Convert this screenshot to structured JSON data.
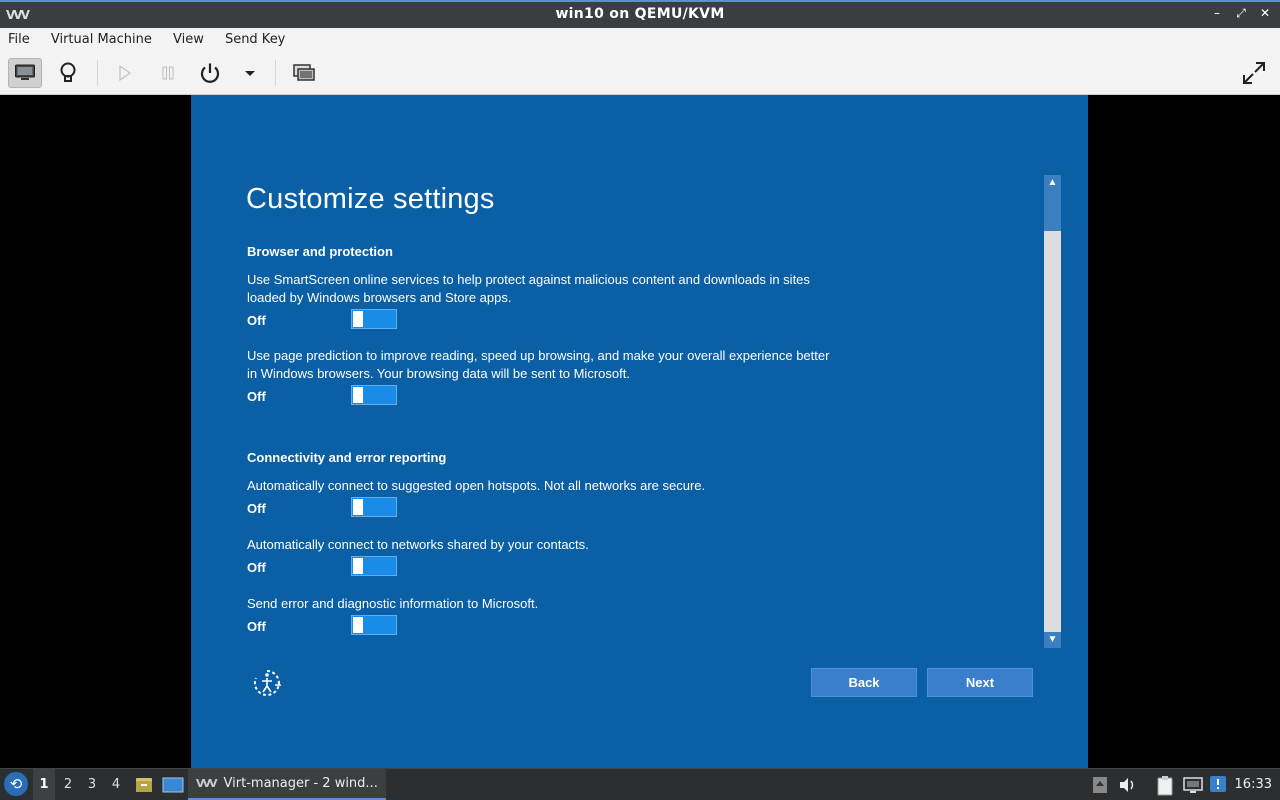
{
  "window": {
    "title": "win10 on QEMU/KVM",
    "app_icon_glyph": "VVV",
    "controls": {
      "minimize": "–",
      "maximize": "⤢",
      "close": "✕"
    }
  },
  "menubar": {
    "items": [
      "File",
      "Virtual Machine",
      "View",
      "Send Key"
    ]
  },
  "toolbar": {
    "icons": [
      "console-monitor-icon",
      "details-lightbulb-icon",
      "run-play-icon",
      "pause-icon",
      "power-icon",
      "power-menu-dropdown-icon",
      "snapshots-icon",
      "fullscreen-icon"
    ]
  },
  "oobe": {
    "heading": "Customize settings",
    "sections": [
      {
        "title": "Browser and protection",
        "settings": [
          {
            "text": "Use SmartScreen online services to help protect against malicious content and downloads in sites loaded by Windows browsers and Store apps.",
            "state": "Off"
          },
          {
            "text": "Use page prediction to improve reading, speed up browsing, and make your overall experience better in Windows browsers. Your browsing data will be sent to Microsoft.",
            "state": "Off"
          }
        ]
      },
      {
        "title": "Connectivity and error reporting",
        "settings": [
          {
            "text": "Automatically connect to suggested open hotspots. Not all networks are secure.",
            "state": "Off"
          },
          {
            "text": "Automatically connect to networks shared by your contacts.",
            "state": "Off"
          },
          {
            "text": "Send error and diagnostic information to Microsoft.",
            "state": "Off"
          }
        ]
      }
    ],
    "back_label": "Back",
    "next_label": "Next",
    "colors": {
      "background": "#0a5fa5",
      "toggle": "#1a8be6",
      "button": "#3a7fcb"
    }
  },
  "taskbar": {
    "start_glyph": "⟲",
    "workspaces": [
      "1",
      "2",
      "3",
      "4"
    ],
    "active_workspace": "1",
    "task": {
      "icon_glyph": "VVV",
      "label": "Virt-manager - 2 wind..."
    },
    "clock": "16:33"
  }
}
